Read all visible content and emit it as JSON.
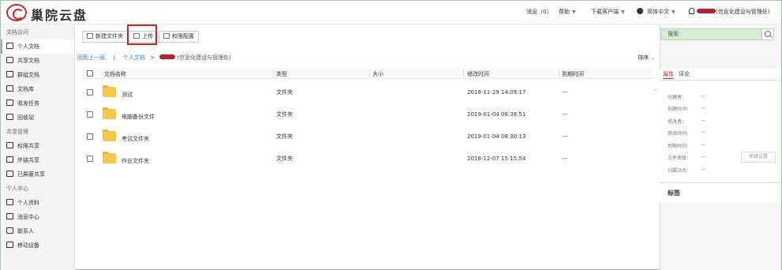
{
  "app": {
    "title": "巢院云盘"
  },
  "topnav": {
    "messages": "消息（0）",
    "help": "帮助",
    "download": "下载客户端",
    "language": "简体中文",
    "user": "(信息化建设与管理处)"
  },
  "toolbar": {
    "new_folder": "新建文件夹",
    "upload": "上传",
    "permissions": "权限配置"
  },
  "search": {
    "placeholder": "搜索"
  },
  "sidebar": {
    "sections": [
      {
        "title": "文档访问"
      },
      {
        "title": "共享管理"
      },
      {
        "title": "个人中心"
      }
    ],
    "items": [
      {
        "label": "个人文档"
      },
      {
        "label": "共享文档"
      },
      {
        "label": "群组文档"
      },
      {
        "label": "文档库"
      },
      {
        "label": "收发任务"
      },
      {
        "label": "回收站"
      },
      {
        "label": "权限共享"
      },
      {
        "label": "外链共享"
      },
      {
        "label": "已屏蔽共享"
      },
      {
        "label": "个人资料"
      },
      {
        "label": "消息中心"
      },
      {
        "label": "联系人"
      },
      {
        "label": "移动设备"
      }
    ]
  },
  "breadcrumb": {
    "back": "回到上一层",
    "separator": "|",
    "root": "个人文档",
    "arrow": ">",
    "current": "(信息化建设与管理处)"
  },
  "sort": {
    "label": "排序"
  },
  "table": {
    "headers": [
      "文档名称",
      "类型",
      "大小",
      "修改时间",
      "到期时间"
    ],
    "rows": [
      {
        "name": "测试",
        "type": "文件夹",
        "size": "",
        "modified": "2018-11-29 14:09:17",
        "expires": "---"
      },
      {
        "name": "电脑备份文件",
        "type": "文件夹",
        "size": "",
        "modified": "2019-01-04 08:38:51",
        "expires": "---"
      },
      {
        "name": "考试文件夹",
        "type": "文件夹",
        "size": "",
        "modified": "2019-01-04 08:30:13",
        "expires": "---"
      },
      {
        "name": "作业文件夹",
        "type": "文件夹",
        "size": "",
        "modified": "2018-12-07 15:15:54",
        "expires": "---"
      }
    ]
  },
  "properties": {
    "tabs": [
      "属性",
      "评论"
    ],
    "fields": [
      {
        "label": "创建者：",
        "value": "---"
      },
      {
        "label": "创建时间：",
        "value": "---"
      },
      {
        "label": "修改者：",
        "value": "---"
      },
      {
        "label": "修改时间：",
        "value": "---"
      },
      {
        "label": "到期时间：",
        "value": "---"
      },
      {
        "label": "文件密级：",
        "value": "---"
      },
      {
        "label": "归属站点：",
        "value": "---"
      }
    ],
    "lock_button": "密级设置"
  },
  "tags": {
    "title": "标签"
  }
}
